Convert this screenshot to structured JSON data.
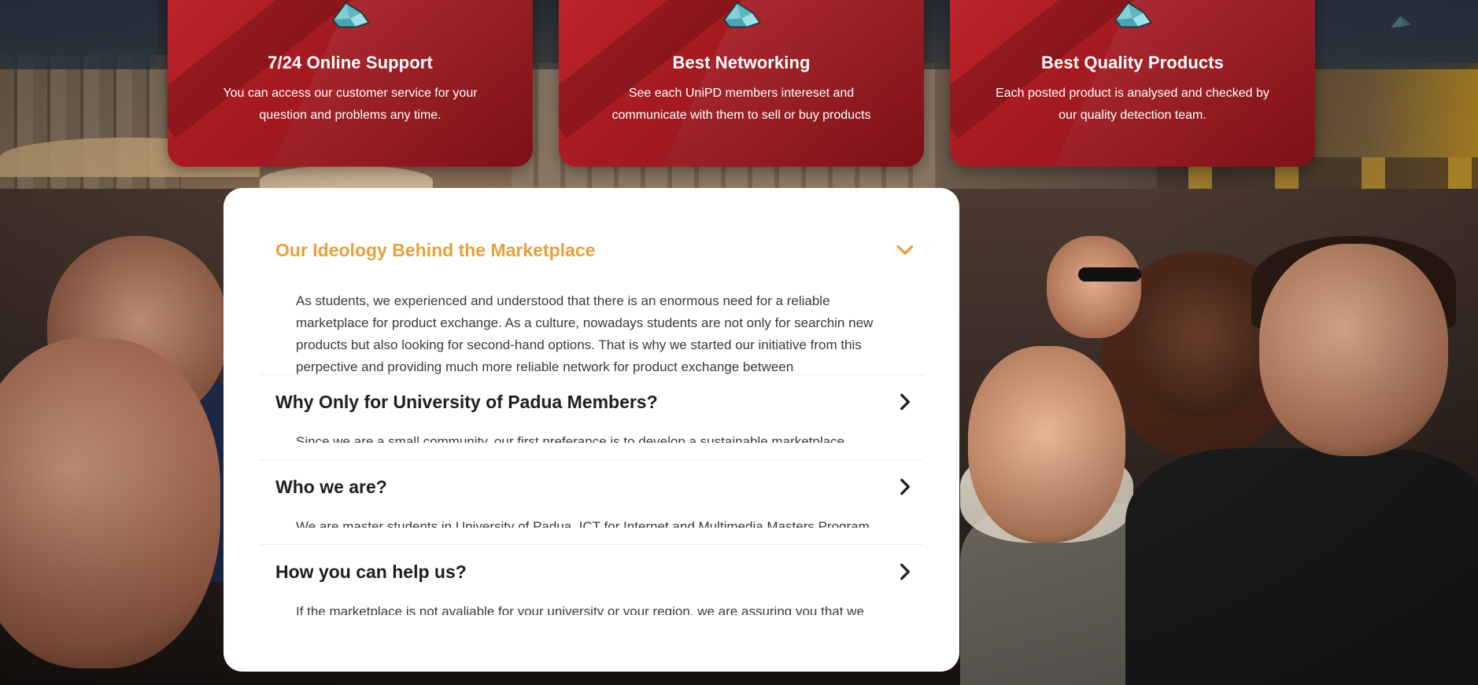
{
  "features": [
    {
      "title": "7/24 Online Support",
      "text": "You can access our customer service for your question and problems any time.",
      "icon": "origami-bird-icon"
    },
    {
      "title": "Best Networking",
      "text": "See each UniPD members intereset and communicate with them to sell or buy products",
      "icon": "origami-bird-icon"
    },
    {
      "title": "Best Quality Products",
      "text": "Each posted product is analysed and checked by our quality detection team.",
      "icon": "origami-bird-icon"
    }
  ],
  "faq": [
    {
      "title": "Our Ideology Behind the Marketplace",
      "body": "As students, we experienced and understood that there is an enormous need for a reliable marketplace for product exchange. As a culture, nowadays students are not only for searchin new products but also looking for second-hand options. That is why we started our initiative from this perpective and providing much more reliable network for product exchange between",
      "state": "open"
    },
    {
      "title": "Why Only for University of Padua Members?",
      "body": "Since we are a small community, our first preferance is to develop a sustainable marketplace",
      "state": "closed"
    },
    {
      "title": "Who we are?",
      "body": "We are master students in University of Padua, ICT for Internet and Multimedia Masters Program.",
      "state": "closed"
    },
    {
      "title": "How you can help us?",
      "body": "If the marketplace is not avaliable for your university or your region, we are assuring you that we",
      "state": "closed"
    }
  ],
  "colors": {
    "card_red": "#b01f25",
    "accent_orange": "#e5a13c",
    "icon_teal": "#7fd0d8"
  }
}
